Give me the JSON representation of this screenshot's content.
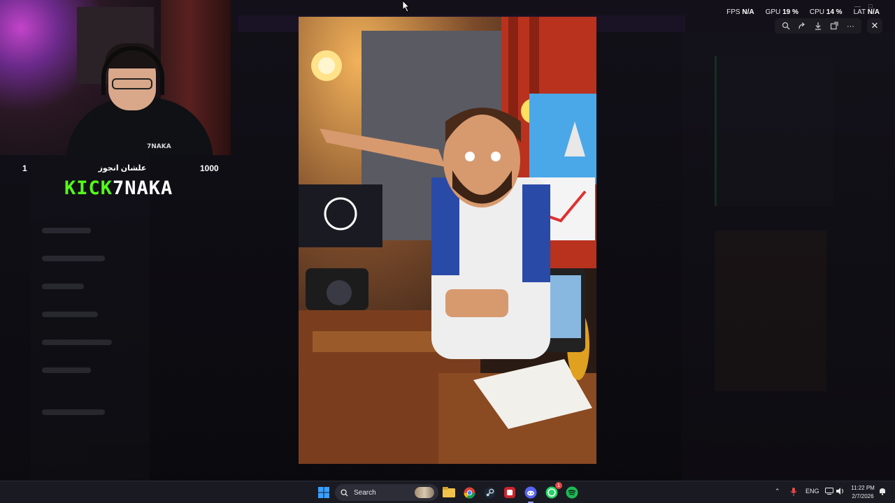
{
  "webcam_overlay": {
    "left_number": "1",
    "arabic_text": "علشان انجوز",
    "right_number": "1000",
    "brand_green": "KICK",
    "brand_white": "7NAKA",
    "shirt_logo": "7NAKA"
  },
  "stats": [
    {
      "key": "FPS",
      "value": "N/A"
    },
    {
      "key": "GPU",
      "value": "19 %"
    },
    {
      "key": "CPU",
      "value": "14 %"
    },
    {
      "key": "LAT",
      "value": "N/A"
    }
  ],
  "viewer_toolbar": {
    "icons": [
      "zoom-icon",
      "forward-icon",
      "download-icon",
      "open-external-icon",
      "more-icon"
    ],
    "close_icon": "close-icon"
  },
  "taskbar": {
    "search_label": "Search",
    "language": "ENG",
    "time": "11:22 PM",
    "date": "2/7/2026",
    "notification_count": "1",
    "apps": [
      "windows-start-icon",
      "file-explorer-icon",
      "chrome-icon",
      "steam-icon",
      "app-red-icon",
      "discord-icon",
      "whatsapp-icon",
      "spotify-icon"
    ]
  },
  "colors": {
    "brand_green": "#53fc18",
    "taskbar_bg": "#1a1b22",
    "discord_purple": "#5865f2"
  }
}
